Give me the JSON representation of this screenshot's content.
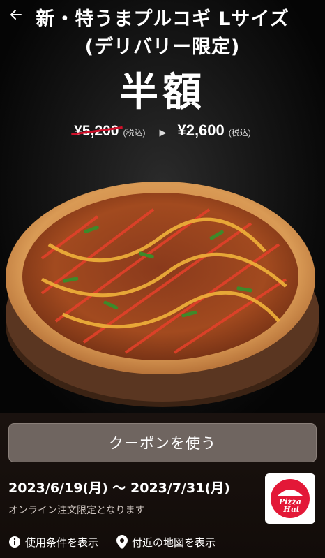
{
  "header": {
    "back_icon": "arrow-left-icon",
    "title_line1": "新・特うまプルコギ Lサイズ",
    "title_line2": "(デリバリー限定)"
  },
  "offer": {
    "discount_label": "半額",
    "old_price": "¥5,200",
    "old_price_tax": "(税込)",
    "arrow": "▶",
    "new_price": "¥2,600",
    "new_price_tax": "(税込)"
  },
  "coupon": {
    "button_label": "クーポンを使う",
    "period": "2023/6/19(月) 〜 2023/7/31(月)",
    "note": "オンライン注文限定となります",
    "logo_text_line1": "Pizza",
    "logo_text_line2": "Hut"
  },
  "links": {
    "terms_label": "使用条件を表示",
    "terms_icon": "info-icon",
    "map_label": "付近の地図を表示",
    "map_icon": "location-pin-icon"
  },
  "colors": {
    "accent_red": "#d0112b",
    "button_bg": "#6f6560",
    "bottom_bg": "#1a120f"
  }
}
